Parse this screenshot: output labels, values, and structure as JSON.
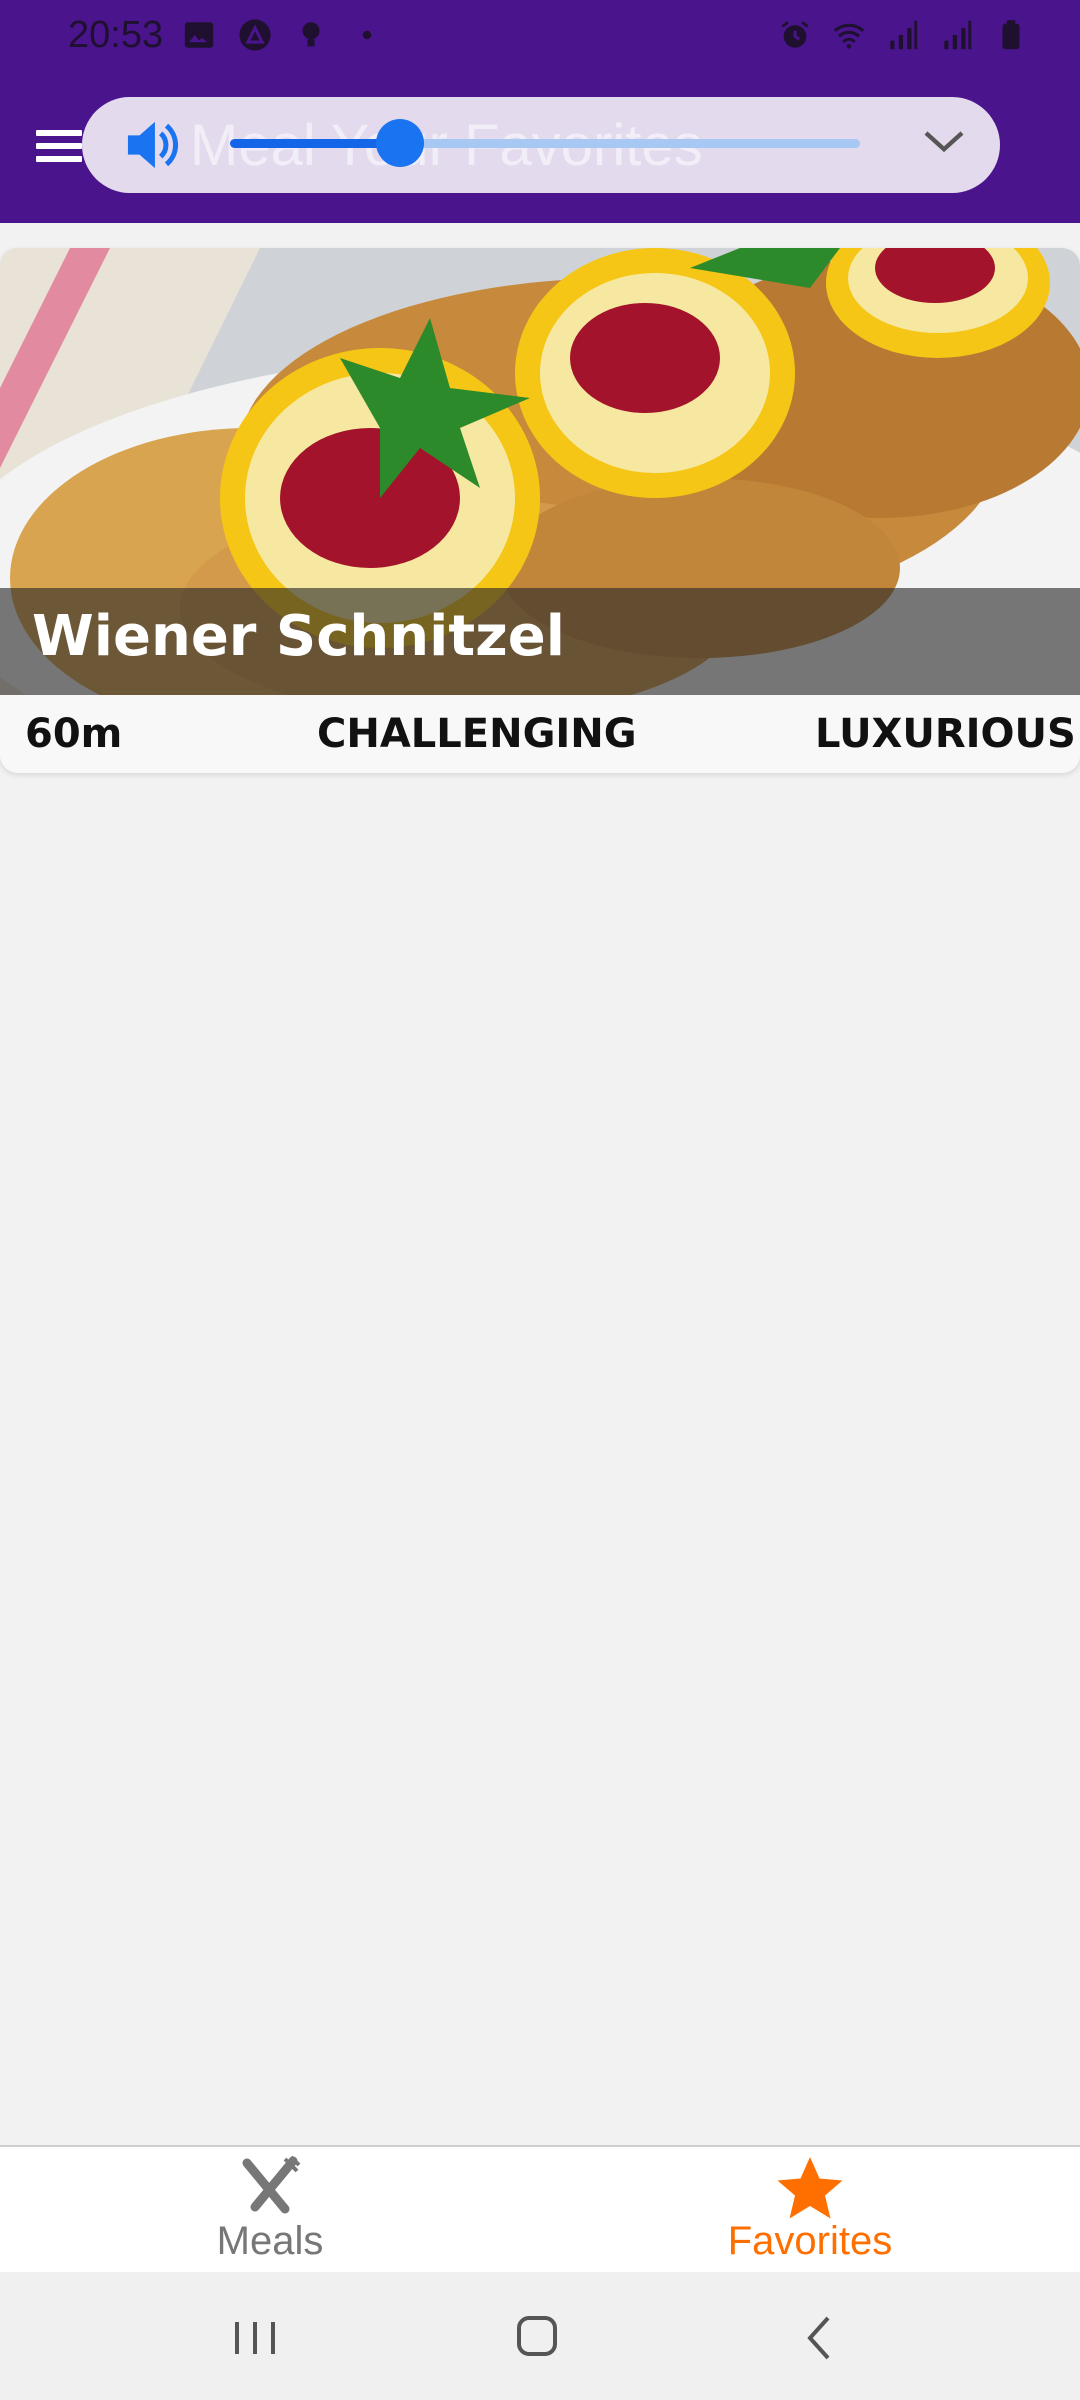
{
  "status_bar": {
    "time": "20:53",
    "left_icons": [
      "image-icon",
      "app-icon",
      "bulb-icon",
      "dot-icon"
    ],
    "right_icons": [
      "alarm-icon",
      "wifi-icon",
      "signal-icon",
      "signal-icon",
      "battery-icon"
    ]
  },
  "app_bar": {
    "title": "Meal Your Favorites",
    "menu_icon": "hamburger-icon"
  },
  "volume_panel": {
    "icon": "speaker-icon",
    "level": 0.27,
    "expand_icon": "chevron-down-icon"
  },
  "meals": [
    {
      "title": "Wiener Schnitzel",
      "duration": "60m",
      "complexity": "CHALLENGING",
      "affordability": "LUXURIOUS"
    }
  ],
  "tabs": [
    {
      "label": "Meals",
      "icon": "cutlery-icon",
      "active": false
    },
    {
      "label": "Favorites",
      "icon": "star-icon",
      "active": true
    }
  ],
  "colors": {
    "primary": "#4a148c",
    "accent": "#ff6f00",
    "inactive_tab": "#777777",
    "slider": "#1a73f0"
  },
  "nav_bar": [
    "recents-icon",
    "home-icon",
    "back-icon"
  ]
}
